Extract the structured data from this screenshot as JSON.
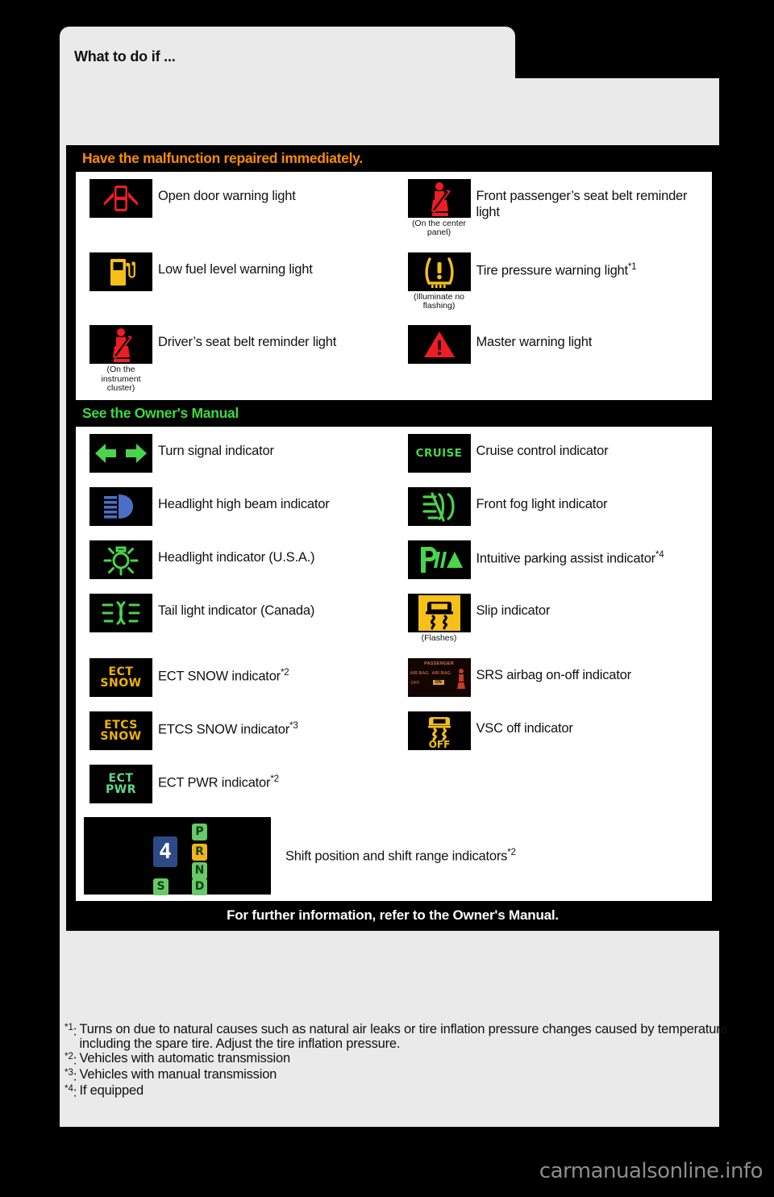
{
  "page": {
    "tab_title": "What to do if ...",
    "watermark": "carmanualsonline.info"
  },
  "sections": [
    {
      "id": "have-malfunction-repaired",
      "heading": "Have the malfunction repaired immediately.",
      "heading_color": "#ff8c00",
      "rows": [
        {
          "left": {
            "icon": "open-door-warning-icon",
            "label": "Open door warning light",
            "note": ""
          },
          "right": {
            "icon": "front-passenger-seat-belt-reminder-icon",
            "label": "Front passenger’s seat belt reminder light",
            "note": "(On the center panel)"
          }
        },
        {
          "left": {
            "icon": "low-fuel-level-warning-icon",
            "label": "Low fuel level warning light",
            "note": ""
          },
          "right": {
            "icon": "tire-pressure-warning-icon",
            "label": "Tire pressure warning light",
            "sup": "*1",
            "note": "(Illuminate no flashing)"
          }
        },
        {
          "left": {
            "icon": "driver-seat-belt-reminder-icon",
            "label": "Driver’s seat belt reminder light",
            "note": "(On the instrument cluster)"
          },
          "right": {
            "icon": "master-warning-icon",
            "label": "Master warning light",
            "note": ""
          }
        }
      ]
    },
    {
      "id": "see-the-owners-manual",
      "heading": "See the Owner's Manual",
      "heading_color": "#3ddb3d",
      "rows": [
        {
          "left": {
            "icon": "turn-signal-indicator-icon",
            "label": "Turn signal indicator",
            "note": ""
          },
          "right": {
            "icon": "cruise-control-indicator-icon",
            "label": "Cruise control indicator",
            "note": ""
          }
        },
        {
          "left": {
            "icon": "headlight-high-beam-indicator-icon",
            "label": "Headlight high beam indicator",
            "note": ""
          },
          "right": {
            "icon": "front-fog-light-indicator-icon",
            "label": "Front fog light indicator",
            "note": ""
          }
        },
        {
          "left": {
            "icon": "headlight-indicator-icon",
            "label": "Headlight indicator (U.S.A.)",
            "note": ""
          },
          "right": {
            "icon": "intuitive-parking-assist-indicator-icon",
            "label": "Intuitive parking assist indicator",
            "sup": "*4",
            "note": ""
          }
        },
        {
          "left": {
            "icon": "tail-light-indicator-icon",
            "label": "Tail light indicator (Canada)",
            "note": ""
          },
          "right": {
            "icon": "slip-indicator-icon",
            "label": "Slip indicator",
            "note": "(Flashes)"
          }
        },
        {
          "left": {
            "icon": "ect-snow-indicator-icon",
            "label": "ECT SNOW indicator",
            "sup": "*2",
            "note": ""
          },
          "right": {
            "icon": "srs-airbag-on-off-indicator-icon",
            "label": "SRS airbag on-off indicator",
            "note": ""
          }
        },
        {
          "left": {
            "icon": "etcs-snow-indicator-icon",
            "label": "ETCS SNOW indicator",
            "sup": "*3",
            "note": ""
          },
          "right": {
            "icon": "vsc-off-indicator-icon",
            "label": "VSC off indicator",
            "note": ""
          }
        },
        {
          "left": {
            "icon": "ect-pwr-indicator-icon",
            "label": "ECT PWR indicator",
            "sup": "*2",
            "note": ""
          },
          "right": null
        }
      ],
      "wide_row": {
        "icon": "shift-position-display-icon",
        "label": "Shift position and shift range indicators",
        "sup": "*2"
      },
      "footer": "For further information, refer to the Owner's Manual."
    }
  ],
  "icon_text": {
    "cruise": "CRUISE",
    "ect_snow_1": "ECT",
    "ect_snow_2": "SNOW",
    "etcs_snow_1": "ETCS",
    "etcs_snow_2": "SNOW",
    "ect_pwr_1": "ECT",
    "ect_pwr_2": "PWR",
    "vsc_off": "OFF",
    "srs_passenger": "PASSENGER",
    "srs_airbag_left": "AIR BAG",
    "srs_airbag_right": "AIR BAG",
    "srs_off": "OFF",
    "srs_on": "ON",
    "shift_gear": "4",
    "shift_p": "P",
    "shift_r": "R",
    "shift_n": "N",
    "shift_d": "D",
    "shift_s": "S"
  },
  "footnotes": [
    {
      "marker": "*1",
      "text": "Turns on due to natural causes such as natural air leaks or tire inflation pressure changes caused by temperature including the spare tire. Adjust the tire inflation pressure."
    },
    {
      "marker": "*2",
      "text": "Vehicles with automatic transmission"
    },
    {
      "marker": "*3",
      "text": "Vehicles with manual transmission"
    },
    {
      "marker": "*4",
      "text": "If equipped"
    }
  ],
  "colors": {
    "warning_red": "#ee1c25",
    "warning_amber": "#f5c01a",
    "indicator_green": "#4ad44a",
    "highbeam_blue": "#4a6fc4",
    "section_orange": "#ff8c00",
    "section_green": "#3ddb3d",
    "page_bg": "#eaeaea"
  }
}
